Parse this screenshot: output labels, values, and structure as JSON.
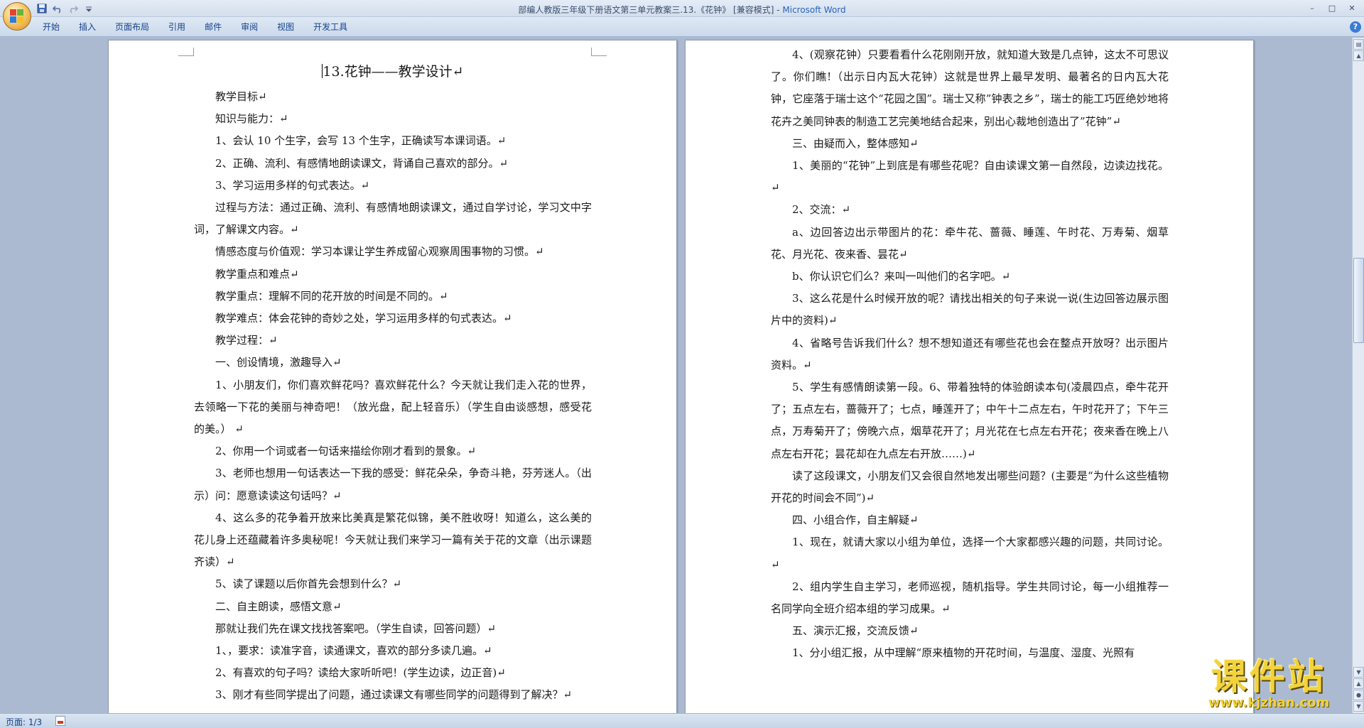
{
  "window": {
    "title_prefix": "部编人教版三年级下册语文第三单元教案三.13.《花钟》 [兼容模式] - ",
    "title_app": "Microsoft Word",
    "controls": [
      "–",
      "□",
      "✕"
    ]
  },
  "quick_access": [
    "save-icon",
    "undo-icon",
    "redo-icon",
    "customize-icon"
  ],
  "ribbon": {
    "tabs": [
      "开始",
      "插入",
      "页面布局",
      "引用",
      "邮件",
      "审阅",
      "视图",
      "开发工具"
    ],
    "help": "?"
  },
  "page1": {
    "title": "13.花钟——教学设计↵",
    "paragraphs": [
      "教学目标↵",
      "知识与能力：↵",
      "1、会认 10 个生字，会写 13 个生字，正确读写本课词语。↵",
      "2、正确、流利、有感情地朗读课文，背诵自己喜欢的部分。↵",
      "3、学习运用多样的句式表达。↵",
      "过程与方法：通过正确、流利、有感情地朗读课文，通过自学讨论，学习文中字词，了解课文内容。↵",
      "情感态度与价值观：学习本课让学生养成留心观察周围事物的习惯。↵",
      "教学重点和难点↵",
      "教学重点：理解不同的花开放的时间是不同的。↵",
      "教学难点：体会花钟的奇妙之处，学习运用多样的句式表达。↵",
      "教学过程：↵",
      " 一、创设情境，激趣导入↵",
      "1、小朋友们，你们喜欢鲜花吗？喜欢鲜花什么？今天就让我们走入花的世界，去领略一下花的美丽与神奇吧！（放光盘，配上轻音乐）（学生自由谈感想，感受花的美。）        ↵",
      "2、你用一个词或者一句话来描绘你刚才看到的景象。↵",
      "3、老师也想用一句话表达一下我的感受：鲜花朵朵，争奇斗艳，芬芳迷人。（出示）问：愿意读读这句话吗？↵",
      "4、这么多的花争着开放来比美真是繁花似锦，美不胜收呀！知道么，这么美的花儿身上还蕴藏着许多奥秘呢！今天就让我们来学习一篇有关于花的文章（出示课题   齐读）↵",
      "5、读了课题以后你首先会想到什么？↵",
      "二、自主朗读，感悟文意↵",
      "那就让我们先在课文找找答案吧。（学生自读，回答问题）↵",
      "1、，要求：读准字音，读通课文，喜欢的部分多读几遍。↵",
      "2、有喜欢的句子吗？读给大家听听吧！(学生边读，边正音)↵",
      "3、刚才有些同学提出了问题，通过读课文有哪些同学的问题得到了解决？↵"
    ]
  },
  "page2": {
    "paragraphs": [
      "4、(观察花钟）只要看看什么花刚刚开放，就知道大致是几点钟，这太不可思议了。你们瞧!（出示日内瓦大花钟）这就是世界上最早发明、最著名的日内瓦大花钟，它座落于瑞士这个“花园之国”。瑞士又称”钟表之乡”，瑞士的能工巧匠绝妙地将花卉之美同钟表的制造工艺完美地结合起来，别出心裁地创造出了”花钟”↵",
      "三、由疑而入，整体感知↵",
      "1、美丽的“花钟”上到底是有哪些花呢？自由读课文第一自然段，边读边找花。↵",
      "2、交流：↵",
      "a、边回答边出示带图片的花：牵牛花、蔷薇、睡莲、午时花、万寿菊、烟草花、月光花、夜来香、昙花↵",
      "b、你认识它们么？来叫一叫他们的名字吧。↵",
      "3、这么花是什么时候开放的呢？请找出相关的句子来说一说(生边回答边展示图片中的资料)↵",
      "4、省略号告诉我们什么？想不想知道还有哪些花也会在整点开放呀？出示图片资料。↵",
      "5、学生有感情朗读第一段。6、带着独特的体验朗读本句(凌晨四点，牵牛花开了；五点左右，蔷薇开了；七点，睡莲开了；中午十二点左右，午时花开了；下午三点，万寿菊开了；傍晚六点，烟草花开了；月光花在七点左右开花；夜来香在晚上八点左右开花；昙花却在九点左右开放……)↵",
      "读了这段课文，小朋友们又会很自然地发出哪些问题？(主要是“为什么这些植物开花的时间会不同”)↵",
      "四、小组合作，自主解疑↵",
      "1、现在，就请大家以小组为单位，选择一个大家都感兴趣的问题，共同讨论。↵",
      " 2、组内学生自主学习，老师巡视，随机指导。学生共同讨论，每一小组推荐一名同学向全班介绍本组的学习成果。↵",
      " 五、演示汇报，交流反馈↵",
      "1、分小组汇报，从中理解“原来植物的开花时间，与温度、湿度、光照有"
    ]
  },
  "status": {
    "page": "页面: 1/3"
  },
  "watermark": {
    "text": "课件站",
    "url": "www.kjzhan.com"
  }
}
